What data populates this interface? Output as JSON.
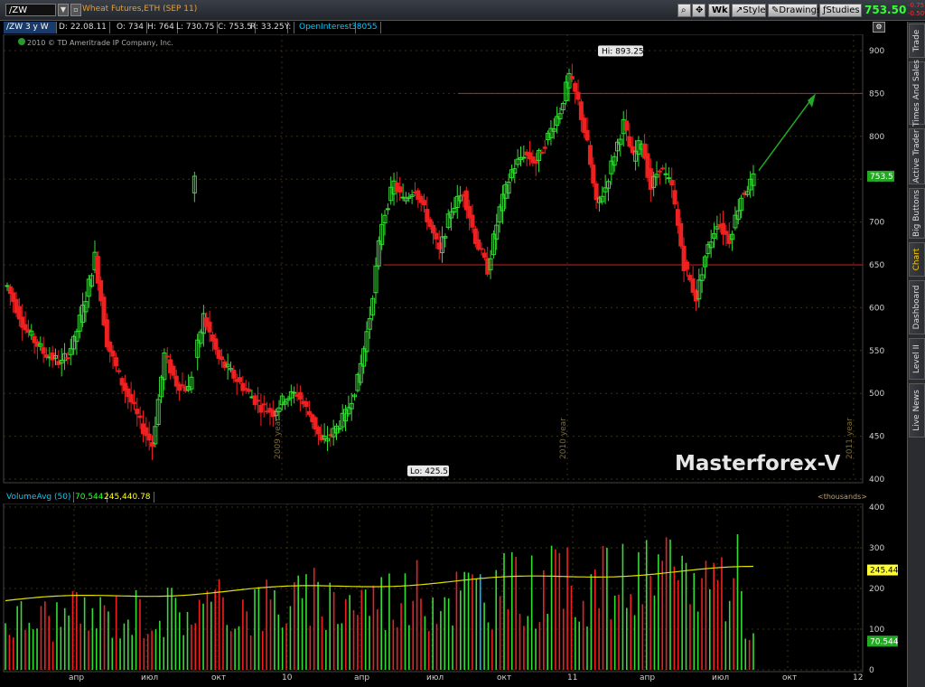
{
  "topbar": {
    "symbol": "/ZW",
    "description": "Wheat Futures,ETH (SEP 11)",
    "wk_label": "Wk",
    "style_label": "Style",
    "drawings_label": "Drawings",
    "studies_label": "Studies",
    "last_price": "753.50",
    "change_abs": "-0.75",
    "change_pct": "-0.50%"
  },
  "infobar": {
    "chart_name": "/ZW 3 y W",
    "date": "D: 22.08.11",
    "open": "O: 734",
    "high": "H: 764",
    "low": "L: 730.75",
    "close": "C: 753.5",
    "range": "R: 33.25",
    "y_label": "Y:",
    "oi_label": "OpenInterest",
    "oi_value": "38055"
  },
  "copyright": "2010 © TD Ameritrade IP Company, Inc.",
  "watermark": "Masterforex-V",
  "volume": {
    "study_label": "VolumeAvg (50)",
    "volume_value": "70,544",
    "avg_value": "245,440.78",
    "units": "<thousands>",
    "avg_marker": "245.44",
    "vol_marker": "70.544"
  },
  "sidebar": {
    "tabs": [
      "Trade",
      "Times And Sales",
      "Active Trader",
      "Big Buttons",
      "Chart",
      "Dashboard",
      "Level II",
      "Live News"
    ]
  },
  "colors": {
    "up": "#33dd33",
    "down": "#ee2020",
    "avg_line": "#e0e000",
    "level_line": "#cc2020",
    "arrow": "#22aa22",
    "grid": "#3a3010"
  },
  "chart_data": {
    "type": "candlestick",
    "price_ylim": [
      400,
      900
    ],
    "price_ticks": [
      400,
      450,
      500,
      550,
      600,
      650,
      700,
      750,
      800,
      850,
      900
    ],
    "price_tick_labels": [
      "400",
      "450",
      "500",
      "550",
      "600",
      "650",
      "700",
      "750",
      "800",
      "850",
      "900"
    ],
    "year_labels": [
      "2009 year",
      "2010 year",
      "2011 year"
    ],
    "hi_label": "Hi: 893.25",
    "lo_label": "Lo: 425.5",
    "hi_value": 893.25,
    "lo_value": 425.5,
    "last_label": "753.5",
    "last_value": 753.5,
    "resistance_level": 850,
    "support_level": 650,
    "volume_ylim": [
      0,
      400
    ],
    "volume_ticks": [
      0,
      100,
      200,
      300,
      400
    ],
    "volume_tick_labels": [
      "0",
      "100",
      "200",
      "300",
      "400"
    ],
    "x_axis_labels": [
      "апр",
      "июл",
      "окт",
      "10",
      "апр",
      "июл",
      "окт",
      "11",
      "апр",
      "июл",
      "окт",
      "12"
    ]
  }
}
